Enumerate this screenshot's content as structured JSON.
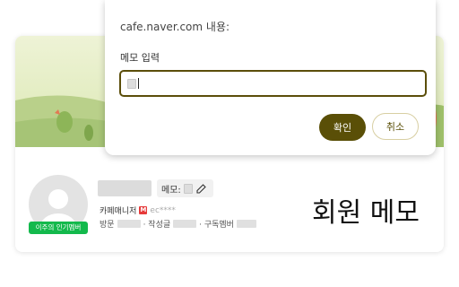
{
  "dialog": {
    "top_text": "cafe.naver.com 내용:",
    "label": "메모 입력",
    "confirm_label": "확인",
    "cancel_label": "취소"
  },
  "profile": {
    "memo_label": "메모:",
    "manager_label": "카페매니저",
    "manager_badge": "M",
    "manager_id": "ec****",
    "badge_text": "이주의 인기멤버",
    "stats": {
      "visits_label": "방문",
      "posts_label": "· 작성글",
      "subscribers_label": "· 구독멤버"
    }
  },
  "caption": "회원 메모",
  "colors": {
    "primary": "#5a4f07",
    "badge_green": "#13b94c",
    "manager_red": "#e63a3a"
  }
}
